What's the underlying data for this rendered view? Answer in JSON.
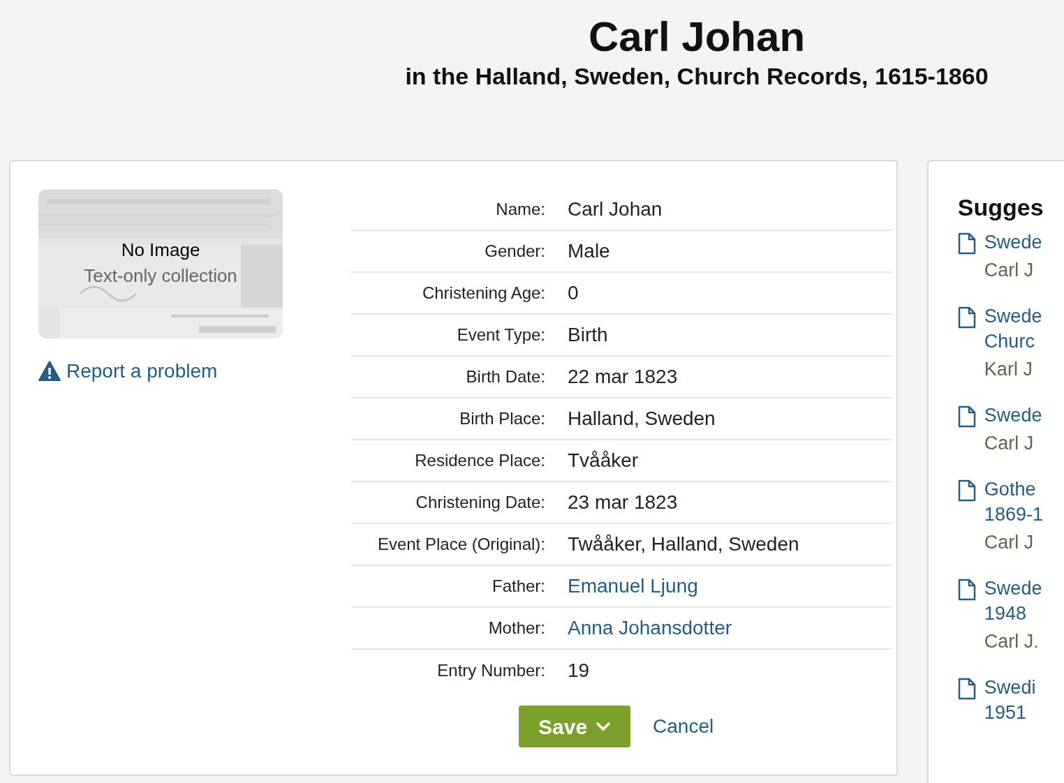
{
  "header": {
    "title": "Carl Johan",
    "subtitle": "in the Halland, Sweden, Church Records, 1615-1860"
  },
  "thumbnail": {
    "kind": "picture",
    "title": "No Image",
    "caption": "Text-only collection"
  },
  "report_link": "Report a problem",
  "fields": [
    {
      "label": "Name:",
      "value": "Carl Johan",
      "kind": "text"
    },
    {
      "label": "Gender:",
      "value": "Male",
      "kind": "text"
    },
    {
      "label": "Christening Age:",
      "value": "0",
      "kind": "text"
    },
    {
      "label": "Event Type:",
      "value": "Birth",
      "kind": "text"
    },
    {
      "label": "Birth Date:",
      "value": "22 mar 1823",
      "kind": "text"
    },
    {
      "label": "Birth Place:",
      "value": "Halland, Sweden",
      "kind": "text"
    },
    {
      "label": "Residence Place:",
      "value": "Tvååker",
      "kind": "text"
    },
    {
      "label": "Christening Date:",
      "value": "23 mar 1823",
      "kind": "text"
    },
    {
      "label": "Event Place (Original):",
      "value": "Twååker, Halland, Sweden",
      "kind": "text"
    },
    {
      "label": "Father:",
      "value": "Emanuel Ljung",
      "kind": "link"
    },
    {
      "label": "Mother:",
      "value": "Anna Johansdotter",
      "kind": "link"
    },
    {
      "label": "Entry Number:",
      "value": "19",
      "kind": "text"
    }
  ],
  "actions": {
    "save": "Save",
    "cancel": "Cancel"
  },
  "suggestions": {
    "title": "Sugges",
    "items": [
      {
        "title": [
          "Swede"
        ],
        "person": "Carl J"
      },
      {
        "title": [
          "Swede",
          "Churc"
        ],
        "person": "Karl J"
      },
      {
        "title": [
          "Swede"
        ],
        "person": "Carl J"
      },
      {
        "title": [
          "Gothe",
          "1869-1"
        ],
        "person": "Carl J"
      },
      {
        "title": [
          "Swede",
          "1948"
        ],
        "person": "Carl J."
      },
      {
        "title": [
          "Swedi",
          "1951"
        ]
      }
    ]
  }
}
